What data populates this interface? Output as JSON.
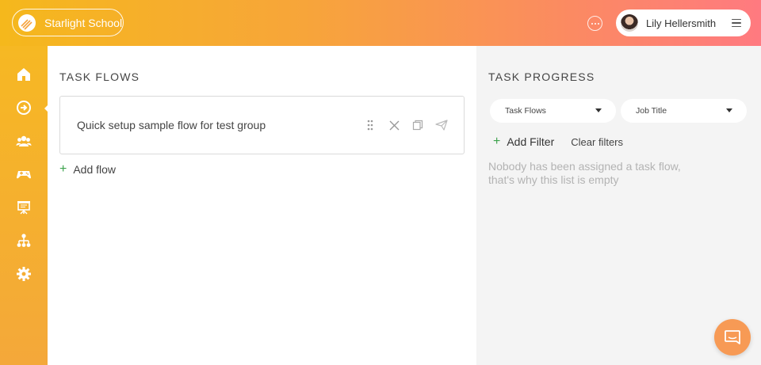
{
  "header": {
    "school_name": "Starlight School",
    "user_name": "Lily Hellersmith"
  },
  "sidebar": {
    "items": [
      {
        "icon": "home-icon"
      },
      {
        "icon": "task-flows-icon",
        "active": true
      },
      {
        "icon": "people-icon"
      },
      {
        "icon": "gamepad-icon"
      },
      {
        "icon": "presentation-icon"
      },
      {
        "icon": "org-chart-icon"
      },
      {
        "icon": "gear-icon"
      }
    ]
  },
  "task_flows": {
    "title": "TASK FLOWS",
    "flows": [
      {
        "name": "Quick setup sample flow for test group"
      }
    ],
    "add_label": "Add flow"
  },
  "task_progress": {
    "title": "TASK PROGRESS",
    "filter_1": "Task Flows",
    "filter_2": "Job Title",
    "add_filter_label": "Add Filter",
    "clear_filters_label": "Clear filters",
    "empty_message": "Nobody has been assigned a task flow, that's why this list is empty"
  },
  "colors": {
    "accent_green": "#3ca24c",
    "chat_button": "#f79a55"
  }
}
